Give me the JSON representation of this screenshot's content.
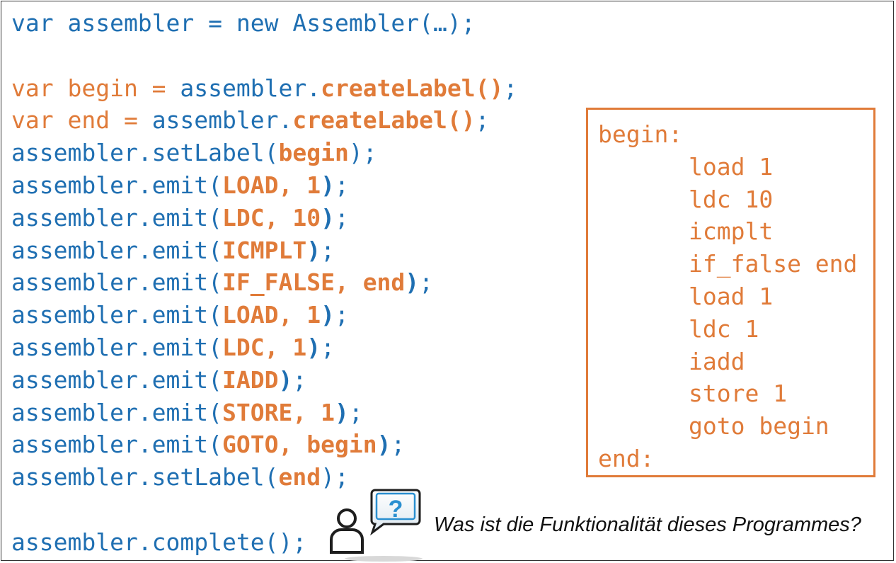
{
  "code_lines": [
    [
      {
        "t": "var assembler = new Assembler(…);",
        "c": "blue",
        "b": false
      }
    ],
    [],
    [
      {
        "t": "var begin = ",
        "c": "orange",
        "b": false
      },
      {
        "t": "assembler.",
        "c": "blue",
        "b": false
      },
      {
        "t": "createLabel()",
        "c": "orange",
        "b": true
      },
      {
        "t": ";",
        "c": "blue",
        "b": false
      }
    ],
    [
      {
        "t": "var end = ",
        "c": "orange",
        "b": false
      },
      {
        "t": "assembler.",
        "c": "blue",
        "b": false
      },
      {
        "t": "createLabel()",
        "c": "orange",
        "b": true
      },
      {
        "t": ";",
        "c": "blue",
        "b": false
      }
    ],
    [
      {
        "t": "assembler.setLabel(",
        "c": "blue",
        "b": false
      },
      {
        "t": "begin",
        "c": "orange",
        "b": true
      },
      {
        "t": ");",
        "c": "blue",
        "b": false
      }
    ],
    [
      {
        "t": "assembler.emit(",
        "c": "blue",
        "b": false
      },
      {
        "t": "LOAD, 1",
        "c": "orange",
        "b": true
      },
      {
        "t": ")",
        "c": "blue",
        "b": true
      },
      {
        "t": ";",
        "c": "blue",
        "b": false
      }
    ],
    [
      {
        "t": "assembler.emit(",
        "c": "blue",
        "b": false
      },
      {
        "t": "LDC, 10",
        "c": "orange",
        "b": true
      },
      {
        "t": ")",
        "c": "blue",
        "b": true
      },
      {
        "t": ";",
        "c": "blue",
        "b": false
      }
    ],
    [
      {
        "t": "assembler.emit(",
        "c": "blue",
        "b": false
      },
      {
        "t": "ICMPLT",
        "c": "orange",
        "b": true
      },
      {
        "t": ")",
        "c": "blue",
        "b": true
      },
      {
        "t": ";",
        "c": "blue",
        "b": false
      }
    ],
    [
      {
        "t": "assembler.emit(",
        "c": "blue",
        "b": false
      },
      {
        "t": "IF_FALSE, end",
        "c": "orange",
        "b": true
      },
      {
        "t": ")",
        "c": "blue",
        "b": true
      },
      {
        "t": ";",
        "c": "blue",
        "b": false
      }
    ],
    [
      {
        "t": "assembler.emit(",
        "c": "blue",
        "b": false
      },
      {
        "t": "LOAD, 1",
        "c": "orange",
        "b": true
      },
      {
        "t": ")",
        "c": "blue",
        "b": true
      },
      {
        "t": ";",
        "c": "blue",
        "b": false
      }
    ],
    [
      {
        "t": "assembler.emit(",
        "c": "blue",
        "b": false
      },
      {
        "t": "LDC, 1",
        "c": "orange",
        "b": true
      },
      {
        "t": ")",
        "c": "blue",
        "b": true
      },
      {
        "t": ";",
        "c": "blue",
        "b": false
      }
    ],
    [
      {
        "t": "assembler.emit(",
        "c": "blue",
        "b": false
      },
      {
        "t": "IADD",
        "c": "orange",
        "b": true
      },
      {
        "t": ")",
        "c": "blue",
        "b": true
      },
      {
        "t": ";",
        "c": "blue",
        "b": false
      }
    ],
    [
      {
        "t": "assembler.emit(",
        "c": "blue",
        "b": false
      },
      {
        "t": "STORE, 1",
        "c": "orange",
        "b": true
      },
      {
        "t": ")",
        "c": "blue",
        "b": true
      },
      {
        "t": ";",
        "c": "blue",
        "b": false
      }
    ],
    [
      {
        "t": "assembler.emit(",
        "c": "blue",
        "b": false
      },
      {
        "t": "GOTO, begin",
        "c": "orange",
        "b": true
      },
      {
        "t": ")",
        "c": "blue",
        "b": true
      },
      {
        "t": ";",
        "c": "blue",
        "b": false
      }
    ],
    [
      {
        "t": "assembler.setLabel(",
        "c": "blue",
        "b": false
      },
      {
        "t": "end",
        "c": "orange",
        "b": true
      },
      {
        "t": ");",
        "c": "blue",
        "b": false
      }
    ],
    [],
    [
      {
        "t": "assembler.complete();",
        "c": "blue",
        "b": false
      }
    ]
  ],
  "bytecode_box": {
    "lines": [
      {
        "text": "begin:",
        "indent": false
      },
      {
        "text": "load 1",
        "indent": true
      },
      {
        "text": "ldc 10",
        "indent": true
      },
      {
        "text": "icmplt",
        "indent": true
      },
      {
        "text": "if_false end",
        "indent": true
      },
      {
        "text": "load 1",
        "indent": true
      },
      {
        "text": "ldc 1",
        "indent": true
      },
      {
        "text": "iadd",
        "indent": true
      },
      {
        "text": "store 1",
        "indent": true
      },
      {
        "text": "goto begin",
        "indent": true
      },
      {
        "text": "end:",
        "indent": false
      }
    ]
  },
  "question": "Was ist die Funktionalität dieses Programmes?",
  "question_mark": "?",
  "colors": {
    "code_blue": "#1f6fb2",
    "label_orange": "#e07b39",
    "icon_blue": "#2a8fd0"
  },
  "icons": [
    "person-question-icon"
  ]
}
